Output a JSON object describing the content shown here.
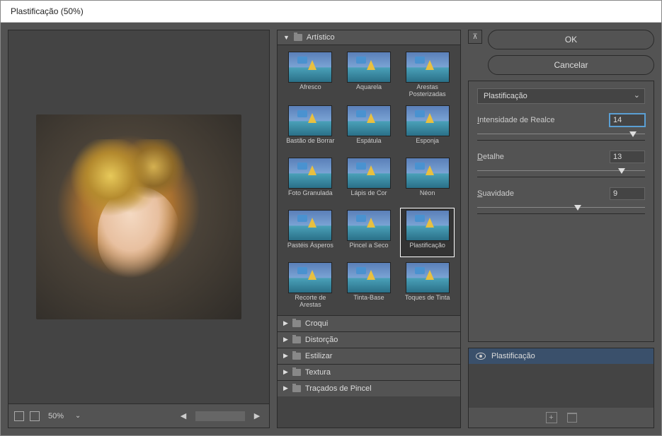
{
  "window": {
    "title": "Plastificação (50%)"
  },
  "preview": {
    "zoom": "50%"
  },
  "gallery": {
    "open_category": "Artístico",
    "thumbs": [
      {
        "label": "Afresco"
      },
      {
        "label": "Aquarela"
      },
      {
        "label": "Arestas Posterizadas"
      },
      {
        "label": "Bastão de Borrar"
      },
      {
        "label": "Espátula"
      },
      {
        "label": "Esponja"
      },
      {
        "label": "Foto Granulada"
      },
      {
        "label": "Lápis de Cor"
      },
      {
        "label": "Néon"
      },
      {
        "label": "Pastéis Ásperos"
      },
      {
        "label": "Pincel a Seco"
      },
      {
        "label": "Plastificação",
        "selected": true
      },
      {
        "label": "Recorte de Arestas"
      },
      {
        "label": "Tinta-Base"
      },
      {
        "label": "Toques de Tinta"
      }
    ],
    "closed_categories": [
      "Croqui",
      "Distorção",
      "Estilizar",
      "Textura",
      "Traçados de Pincel"
    ]
  },
  "buttons": {
    "ok": "OK",
    "cancel": "Cancelar"
  },
  "filter": {
    "name": "Plastificação",
    "params": [
      {
        "label_pre": "I",
        "label": "ntensidade de Realce",
        "value": "14",
        "pos": 93,
        "selected": true
      },
      {
        "label_pre": "D",
        "label": "etalhe",
        "value": "13",
        "pos": 86
      },
      {
        "label_pre": "S",
        "label": "uavidade",
        "value": "9",
        "pos": 60
      }
    ]
  },
  "layers": {
    "active": "Plastificação"
  }
}
